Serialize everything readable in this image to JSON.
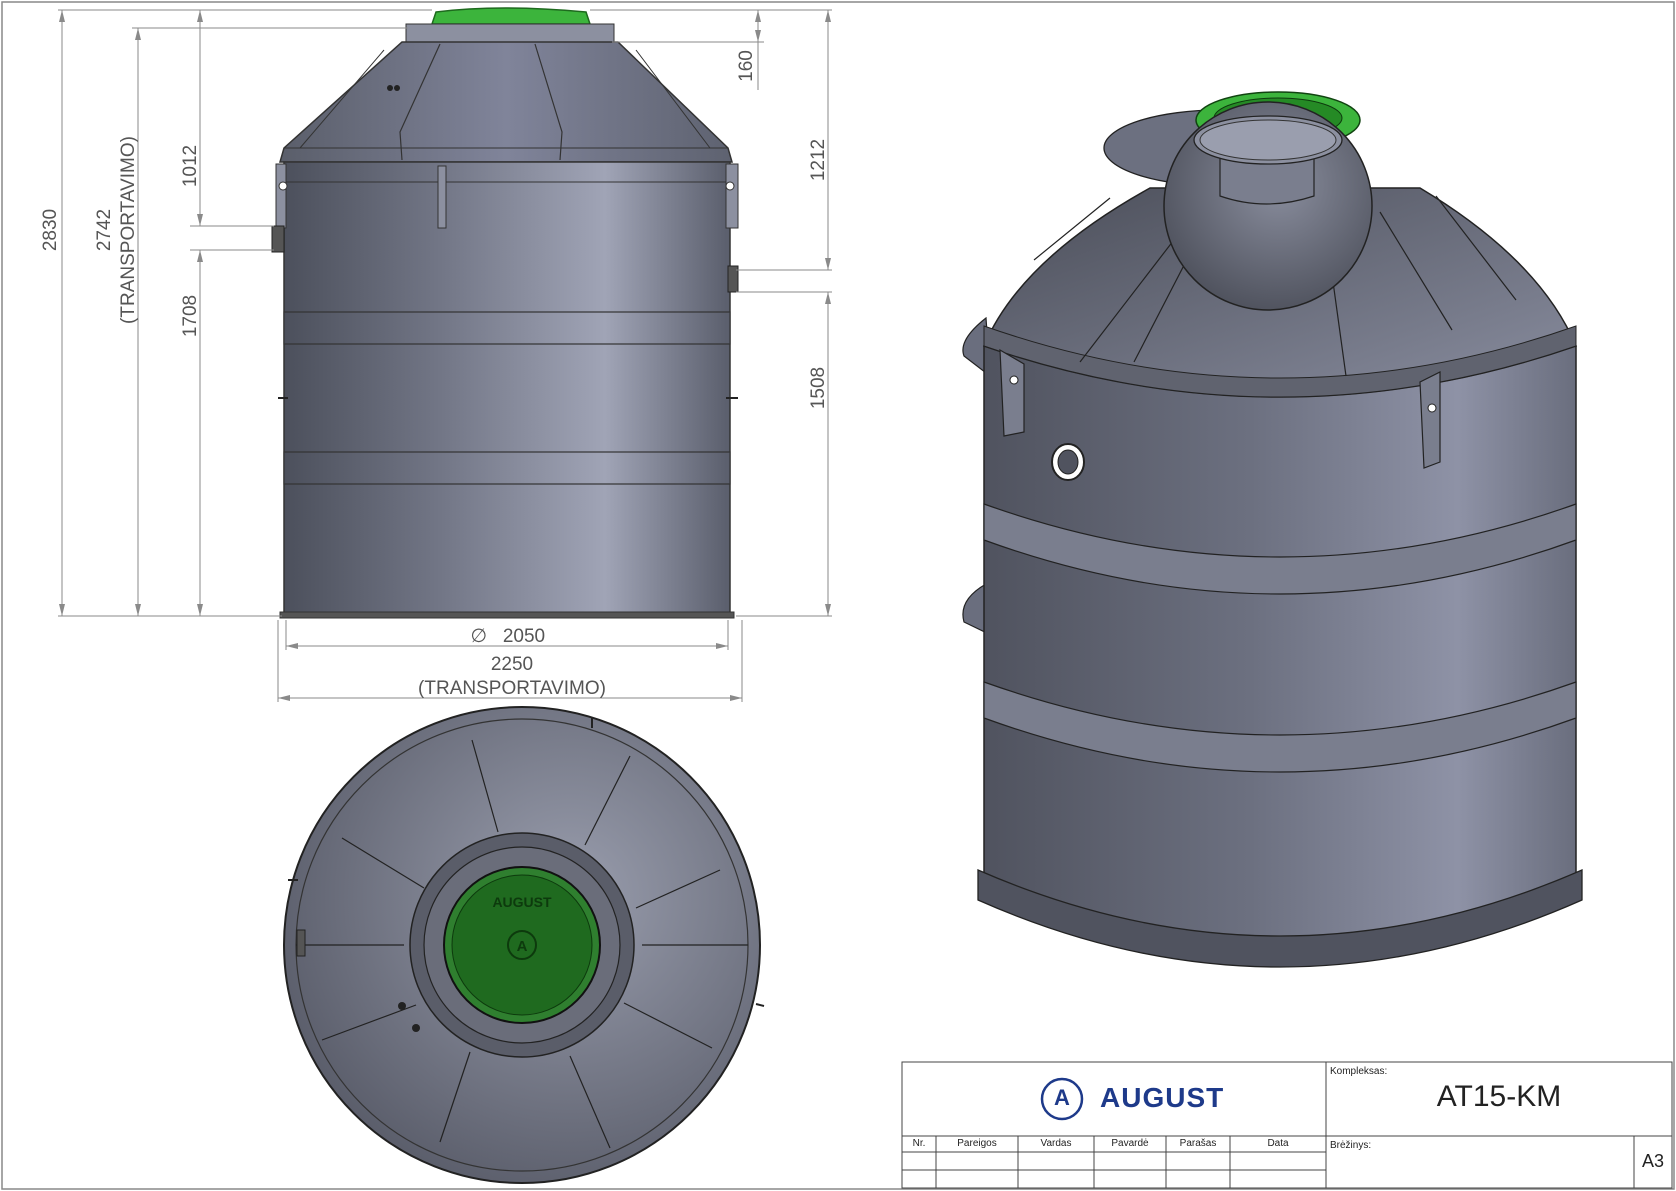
{
  "dimensions": {
    "overall_height": "2830",
    "transport_height": "2742",
    "transport_note": "(TRANSPORTAVIMO)",
    "inlet_to_top": "1012",
    "inlet_height": "1708",
    "neck": "160",
    "outlet_to_top": "1212",
    "outlet_height": "1508",
    "diameter_symbol": "∅",
    "diameter": "2050",
    "transport_width": "2250"
  },
  "cover": {
    "brand": "AUGUST",
    "logo_letter": "A"
  },
  "title_block": {
    "logo_letter": "A",
    "company": "AUGUST",
    "kompleksas_label": "Kompleksas:",
    "kompleksas_value": "AT15-KM",
    "brezinys_label": "Brėžinys:",
    "sheet_size": "A3",
    "columns": [
      "Nr.",
      "Pareigos",
      "Vardas",
      "Pavardė",
      "Parašas",
      "Data"
    ]
  },
  "colors": {
    "tank_body": "#6f7383",
    "tank_dark": "#4a4d58",
    "lid_green": "#3cb43c",
    "logo_blue": "#1e3a8a",
    "dimension_line": "#8a8a8a"
  }
}
